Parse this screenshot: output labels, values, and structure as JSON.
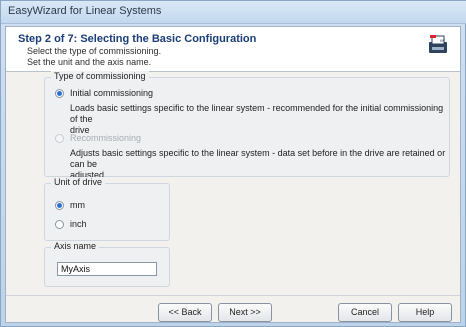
{
  "window": {
    "title": "EasyWizard for Linear Systems"
  },
  "header": {
    "step": "Step 2 of 7: Selecting the Basic Configuration",
    "line1": "Select the type of commissioning.",
    "line2": "Set the unit and the axis name."
  },
  "commissioning": {
    "legend": "Type of commissioning",
    "initial": {
      "label": "Initial commissioning",
      "selected": true,
      "description_line1": "Loads basic settings specific to the linear system - recommended for the initial commissioning of the",
      "description_line2": "drive"
    },
    "recommissioning": {
      "label": "Recommissioning",
      "enabled": false,
      "description_line1": "Adjusts basic settings specific to the linear system - data set before in the drive are retained or can be",
      "description_line2": "adjusted"
    }
  },
  "unit": {
    "legend": "Unit of drive",
    "mm": {
      "label": "mm",
      "selected": true
    },
    "inch": {
      "label": "inch",
      "selected": false
    }
  },
  "axis": {
    "legend": "Axis name",
    "value": "MyAxis"
  },
  "buttons": {
    "back": "<< Back",
    "next": "Next >>",
    "cancel": "Cancel",
    "help": "Help"
  },
  "colors": {
    "accent": "#2c6fd1",
    "header_text": "#1a3e78"
  },
  "icons": {
    "logo": "printer-document-icon"
  }
}
